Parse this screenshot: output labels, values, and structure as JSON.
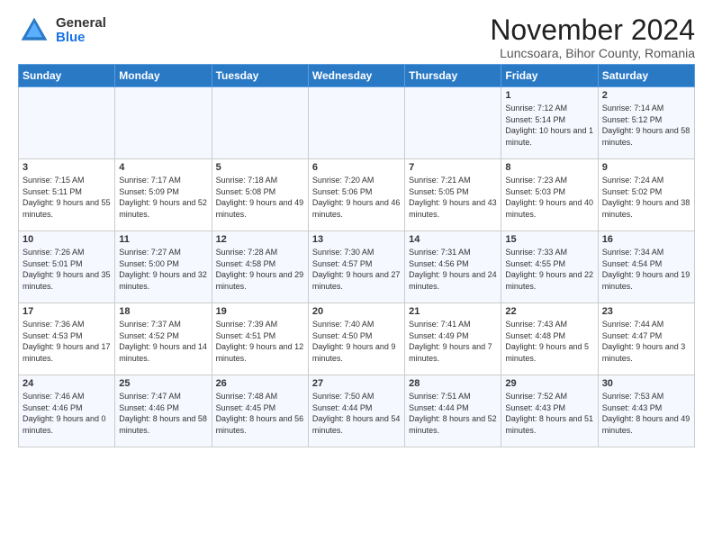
{
  "logo": {
    "general": "General",
    "blue": "Blue"
  },
  "title": "November 2024",
  "subtitle": "Luncsoara, Bihor County, Romania",
  "header": {
    "days": [
      "Sunday",
      "Monday",
      "Tuesday",
      "Wednesday",
      "Thursday",
      "Friday",
      "Saturday"
    ]
  },
  "weeks": [
    [
      {
        "day": "",
        "sunrise": "",
        "sunset": "",
        "daylight": ""
      },
      {
        "day": "",
        "sunrise": "",
        "sunset": "",
        "daylight": ""
      },
      {
        "day": "",
        "sunrise": "",
        "sunset": "",
        "daylight": ""
      },
      {
        "day": "",
        "sunrise": "",
        "sunset": "",
        "daylight": ""
      },
      {
        "day": "",
        "sunrise": "",
        "sunset": "",
        "daylight": ""
      },
      {
        "day": "1",
        "sunrise": "Sunrise: 7:12 AM",
        "sunset": "Sunset: 5:14 PM",
        "daylight": "Daylight: 10 hours and 1 minute."
      },
      {
        "day": "2",
        "sunrise": "Sunrise: 7:14 AM",
        "sunset": "Sunset: 5:12 PM",
        "daylight": "Daylight: 9 hours and 58 minutes."
      }
    ],
    [
      {
        "day": "3",
        "sunrise": "Sunrise: 7:15 AM",
        "sunset": "Sunset: 5:11 PM",
        "daylight": "Daylight: 9 hours and 55 minutes."
      },
      {
        "day": "4",
        "sunrise": "Sunrise: 7:17 AM",
        "sunset": "Sunset: 5:09 PM",
        "daylight": "Daylight: 9 hours and 52 minutes."
      },
      {
        "day": "5",
        "sunrise": "Sunrise: 7:18 AM",
        "sunset": "Sunset: 5:08 PM",
        "daylight": "Daylight: 9 hours and 49 minutes."
      },
      {
        "day": "6",
        "sunrise": "Sunrise: 7:20 AM",
        "sunset": "Sunset: 5:06 PM",
        "daylight": "Daylight: 9 hours and 46 minutes."
      },
      {
        "day": "7",
        "sunrise": "Sunrise: 7:21 AM",
        "sunset": "Sunset: 5:05 PM",
        "daylight": "Daylight: 9 hours and 43 minutes."
      },
      {
        "day": "8",
        "sunrise": "Sunrise: 7:23 AM",
        "sunset": "Sunset: 5:03 PM",
        "daylight": "Daylight: 9 hours and 40 minutes."
      },
      {
        "day": "9",
        "sunrise": "Sunrise: 7:24 AM",
        "sunset": "Sunset: 5:02 PM",
        "daylight": "Daylight: 9 hours and 38 minutes."
      }
    ],
    [
      {
        "day": "10",
        "sunrise": "Sunrise: 7:26 AM",
        "sunset": "Sunset: 5:01 PM",
        "daylight": "Daylight: 9 hours and 35 minutes."
      },
      {
        "day": "11",
        "sunrise": "Sunrise: 7:27 AM",
        "sunset": "Sunset: 5:00 PM",
        "daylight": "Daylight: 9 hours and 32 minutes."
      },
      {
        "day": "12",
        "sunrise": "Sunrise: 7:28 AM",
        "sunset": "Sunset: 4:58 PM",
        "daylight": "Daylight: 9 hours and 29 minutes."
      },
      {
        "day": "13",
        "sunrise": "Sunrise: 7:30 AM",
        "sunset": "Sunset: 4:57 PM",
        "daylight": "Daylight: 9 hours and 27 minutes."
      },
      {
        "day": "14",
        "sunrise": "Sunrise: 7:31 AM",
        "sunset": "Sunset: 4:56 PM",
        "daylight": "Daylight: 9 hours and 24 minutes."
      },
      {
        "day": "15",
        "sunrise": "Sunrise: 7:33 AM",
        "sunset": "Sunset: 4:55 PM",
        "daylight": "Daylight: 9 hours and 22 minutes."
      },
      {
        "day": "16",
        "sunrise": "Sunrise: 7:34 AM",
        "sunset": "Sunset: 4:54 PM",
        "daylight": "Daylight: 9 hours and 19 minutes."
      }
    ],
    [
      {
        "day": "17",
        "sunrise": "Sunrise: 7:36 AM",
        "sunset": "Sunset: 4:53 PM",
        "daylight": "Daylight: 9 hours and 17 minutes."
      },
      {
        "day": "18",
        "sunrise": "Sunrise: 7:37 AM",
        "sunset": "Sunset: 4:52 PM",
        "daylight": "Daylight: 9 hours and 14 minutes."
      },
      {
        "day": "19",
        "sunrise": "Sunrise: 7:39 AM",
        "sunset": "Sunset: 4:51 PM",
        "daylight": "Daylight: 9 hours and 12 minutes."
      },
      {
        "day": "20",
        "sunrise": "Sunrise: 7:40 AM",
        "sunset": "Sunset: 4:50 PM",
        "daylight": "Daylight: 9 hours and 9 minutes."
      },
      {
        "day": "21",
        "sunrise": "Sunrise: 7:41 AM",
        "sunset": "Sunset: 4:49 PM",
        "daylight": "Daylight: 9 hours and 7 minutes."
      },
      {
        "day": "22",
        "sunrise": "Sunrise: 7:43 AM",
        "sunset": "Sunset: 4:48 PM",
        "daylight": "Daylight: 9 hours and 5 minutes."
      },
      {
        "day": "23",
        "sunrise": "Sunrise: 7:44 AM",
        "sunset": "Sunset: 4:47 PM",
        "daylight": "Daylight: 9 hours and 3 minutes."
      }
    ],
    [
      {
        "day": "24",
        "sunrise": "Sunrise: 7:46 AM",
        "sunset": "Sunset: 4:46 PM",
        "daylight": "Daylight: 9 hours and 0 minutes."
      },
      {
        "day": "25",
        "sunrise": "Sunrise: 7:47 AM",
        "sunset": "Sunset: 4:46 PM",
        "daylight": "Daylight: 8 hours and 58 minutes."
      },
      {
        "day": "26",
        "sunrise": "Sunrise: 7:48 AM",
        "sunset": "Sunset: 4:45 PM",
        "daylight": "Daylight: 8 hours and 56 minutes."
      },
      {
        "day": "27",
        "sunrise": "Sunrise: 7:50 AM",
        "sunset": "Sunset: 4:44 PM",
        "daylight": "Daylight: 8 hours and 54 minutes."
      },
      {
        "day": "28",
        "sunrise": "Sunrise: 7:51 AM",
        "sunset": "Sunset: 4:44 PM",
        "daylight": "Daylight: 8 hours and 52 minutes."
      },
      {
        "day": "29",
        "sunrise": "Sunrise: 7:52 AM",
        "sunset": "Sunset: 4:43 PM",
        "daylight": "Daylight: 8 hours and 51 minutes."
      },
      {
        "day": "30",
        "sunrise": "Sunrise: 7:53 AM",
        "sunset": "Sunset: 4:43 PM",
        "daylight": "Daylight: 8 hours and 49 minutes."
      }
    ]
  ]
}
